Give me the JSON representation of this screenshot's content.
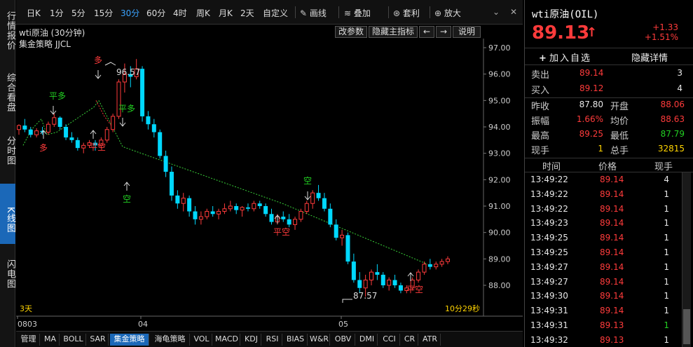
{
  "left_tabs": [
    {
      "label": "行情报价",
      "active": false
    },
    {
      "label": "综合看盘",
      "active": false
    },
    {
      "label": "分时图",
      "active": false
    },
    {
      "label": "K线图",
      "active": true
    },
    {
      "label": "闪电图",
      "active": false
    }
  ],
  "toolbar": {
    "periods": [
      "日K",
      "1分",
      "5分",
      "15分",
      "30分",
      "60分",
      "4时",
      "周K",
      "月K",
      "2天",
      "自定义"
    ],
    "active_period": "30分",
    "tools": [
      {
        "label": "画线",
        "icon": "pencil-icon"
      },
      {
        "label": "叠加",
        "icon": "stack-icon"
      },
      {
        "label": "套利",
        "icon": "arbitrage-icon"
      },
      {
        "label": "放大",
        "icon": "zoom-in-icon"
      }
    ]
  },
  "chart_header": {
    "title": "wti原油 (30分钟)",
    "buttons": [
      "改参数",
      "隐藏主指标",
      "←",
      "→",
      "说明"
    ],
    "indicator": "集金策略 JJCL"
  },
  "chart_data": {
    "type": "candlestick",
    "instrument": "wti原油 (30分钟)",
    "y_ticks": [
      97.0,
      96.0,
      95.0,
      94.0,
      93.0,
      92.0,
      91.0,
      90.0,
      89.0,
      88.0
    ],
    "ylim": [
      87.1,
      97.3
    ],
    "x_ticks": [
      "0803",
      "04",
      "05"
    ],
    "annotations": {
      "high": "96.57",
      "low": "87.57",
      "span": "3天",
      "countdown": "10分29秒"
    },
    "signals": [
      {
        "text": "多",
        "color": "#ff3b3b"
      },
      {
        "text": "平多",
        "color": "#22d022"
      },
      {
        "text": "多",
        "color": "#ff3b3b"
      },
      {
        "text": "平空",
        "color": "#ff3b3b"
      },
      {
        "text": "平多",
        "color": "#22d022"
      },
      {
        "text": "空",
        "color": "#22d022"
      },
      {
        "text": "平空",
        "color": "#ff3b3b"
      },
      {
        "text": "空",
        "color": "#22d022"
      },
      {
        "text": "平空",
        "color": "#ff3b3b"
      }
    ],
    "candles": [
      [
        93.9,
        94.1,
        93.7,
        94.05
      ],
      [
        94.05,
        94.3,
        93.8,
        93.9
      ],
      [
        93.9,
        94.0,
        93.6,
        93.7
      ],
      [
        93.7,
        93.95,
        93.6,
        93.85
      ],
      [
        93.85,
        94.0,
        93.7,
        93.8
      ],
      [
        93.8,
        94.2,
        93.7,
        94.1
      ],
      [
        94.1,
        94.5,
        94.0,
        94.35
      ],
      [
        94.35,
        94.4,
        93.9,
        94.0
      ],
      [
        94.0,
        94.1,
        93.5,
        93.6
      ],
      [
        93.6,
        93.8,
        93.4,
        93.5
      ],
      [
        93.5,
        93.6,
        93.1,
        93.2
      ],
      [
        93.2,
        93.4,
        93.0,
        93.3
      ],
      [
        93.3,
        93.5,
        93.2,
        93.4
      ],
      [
        93.4,
        93.5,
        93.1,
        93.3
      ],
      [
        93.3,
        93.6,
        93.2,
        93.5
      ],
      [
        93.5,
        94.0,
        93.4,
        93.9
      ],
      [
        93.9,
        94.5,
        93.8,
        94.4
      ],
      [
        94.4,
        95.8,
        94.3,
        95.7
      ],
      [
        95.7,
        96.4,
        95.3,
        96.0
      ],
      [
        96.0,
        96.3,
        95.5,
        95.9
      ],
      [
        95.9,
        96.57,
        95.8,
        96.2
      ],
      [
        96.2,
        96.3,
        94.2,
        94.4
      ],
      [
        94.4,
        94.6,
        93.9,
        94.1
      ],
      [
        94.1,
        94.3,
        93.6,
        93.8
      ],
      [
        93.8,
        93.9,
        92.8,
        92.9
      ],
      [
        92.9,
        93.1,
        92.1,
        92.3
      ],
      [
        92.3,
        92.5,
        91.2,
        91.4
      ],
      [
        91.4,
        91.6,
        90.9,
        91.1
      ],
      [
        91.1,
        91.5,
        90.8,
        91.3
      ],
      [
        91.3,
        91.4,
        90.6,
        90.8
      ],
      [
        90.8,
        91.0,
        90.3,
        90.5
      ],
      [
        90.5,
        90.8,
        90.3,
        90.6
      ],
      [
        90.6,
        90.9,
        90.5,
        90.8
      ],
      [
        90.8,
        91.0,
        90.6,
        90.7
      ],
      [
        90.7,
        90.9,
        90.5,
        90.8
      ],
      [
        90.8,
        91.1,
        90.7,
        90.9
      ],
      [
        90.9,
        91.2,
        90.8,
        91.0
      ],
      [
        91.0,
        91.1,
        90.7,
        90.85
      ],
      [
        90.85,
        91.0,
        90.6,
        90.95
      ],
      [
        90.95,
        91.1,
        90.8,
        90.9
      ],
      [
        90.9,
        91.2,
        90.8,
        91.1
      ],
      [
        91.1,
        91.2,
        90.9,
        91.0
      ],
      [
        91.0,
        91.1,
        90.6,
        90.7
      ],
      [
        90.7,
        90.9,
        90.3,
        90.4
      ],
      [
        90.4,
        90.7,
        90.3,
        90.6
      ],
      [
        90.6,
        90.8,
        90.4,
        90.5
      ],
      [
        90.5,
        90.7,
        90.2,
        90.3
      ],
      [
        90.3,
        90.6,
        90.1,
        90.5
      ],
      [
        90.5,
        90.9,
        90.4,
        90.8
      ],
      [
        90.8,
        91.2,
        90.7,
        91.1
      ],
      [
        91.1,
        91.6,
        90.9,
        91.5
      ],
      [
        91.5,
        91.8,
        91.2,
        91.3
      ],
      [
        91.3,
        91.5,
        90.8,
        90.9
      ],
      [
        90.9,
        91.1,
        90.2,
        90.3
      ],
      [
        90.3,
        90.5,
        89.7,
        89.8
      ],
      [
        89.8,
        90.1,
        89.5,
        89.9
      ],
      [
        89.9,
        90.0,
        88.8,
        88.9
      ],
      [
        88.9,
        89.2,
        88.1,
        88.2
      ],
      [
        88.2,
        88.5,
        87.7,
        87.9
      ],
      [
        87.9,
        88.4,
        87.57,
        88.2
      ],
      [
        88.2,
        88.6,
        88.0,
        88.5
      ],
      [
        88.5,
        88.8,
        88.2,
        88.4
      ],
      [
        88.4,
        88.5,
        87.9,
        88.0
      ],
      [
        88.0,
        88.3,
        87.8,
        88.2
      ],
      [
        88.2,
        88.4,
        87.9,
        88.0
      ],
      [
        88.0,
        88.1,
        87.7,
        87.8
      ],
      [
        87.8,
        88.0,
        87.7,
        87.9
      ],
      [
        87.9,
        88.3,
        87.8,
        88.2
      ],
      [
        88.2,
        88.6,
        88.1,
        88.5
      ],
      [
        88.5,
        88.9,
        88.4,
        88.8
      ],
      [
        88.8,
        89.0,
        88.6,
        88.7
      ],
      [
        88.7,
        88.9,
        88.6,
        88.8
      ],
      [
        88.8,
        89.0,
        88.7,
        88.9
      ],
      [
        88.9,
        89.1,
        88.8,
        89.0
      ]
    ]
  },
  "quote": {
    "name": "wti原油(OIL)",
    "price": "89.13",
    "arrow": "↑",
    "change": "+1.33",
    "change_pct": "+1.51%",
    "add_watch": "加入自选",
    "hide_detail": "隐藏详情",
    "sell_label": "卖出",
    "sell_price": "89.14",
    "sell_qty": "3",
    "buy_label": "买入",
    "buy_price": "89.12",
    "buy_qty": "4",
    "stats": [
      {
        "l1": "昨收",
        "v1": "87.80",
        "c1": "white",
        "l2": "开盘",
        "v2": "88.06",
        "c2": "red"
      },
      {
        "l1": "振幅",
        "v1": "1.66%",
        "c1": "red",
        "l2": "均价",
        "v2": "88.63",
        "c2": "red"
      },
      {
        "l1": "最高",
        "v1": "89.25",
        "c1": "red",
        "l2": "最低",
        "v2": "87.79",
        "c2": "green"
      },
      {
        "l1": "现手",
        "v1": "1",
        "c1": "yellow",
        "l2": "总手",
        "v2": "32815",
        "c2": "yellow"
      }
    ],
    "ticks_header": [
      "时间",
      "价格",
      "现手"
    ],
    "ticks": [
      {
        "time": "13:49:22",
        "price": "89.14",
        "pc": "red",
        "qty": "4",
        "qc": "white"
      },
      {
        "time": "13:49:22",
        "price": "89.14",
        "pc": "red",
        "qty": "1",
        "qc": "white"
      },
      {
        "time": "13:49:22",
        "price": "89.14",
        "pc": "red",
        "qty": "1",
        "qc": "white"
      },
      {
        "time": "13:49:23",
        "price": "89.14",
        "pc": "red",
        "qty": "1",
        "qc": "white"
      },
      {
        "time": "13:49:25",
        "price": "89.14",
        "pc": "red",
        "qty": "1",
        "qc": "white"
      },
      {
        "time": "13:49:25",
        "price": "89.14",
        "pc": "red",
        "qty": "1",
        "qc": "white"
      },
      {
        "time": "13:49:27",
        "price": "89.14",
        "pc": "red",
        "qty": "1",
        "qc": "white"
      },
      {
        "time": "13:49:27",
        "price": "89.14",
        "pc": "red",
        "qty": "1",
        "qc": "white"
      },
      {
        "time": "13:49:30",
        "price": "89.14",
        "pc": "red",
        "qty": "1",
        "qc": "white"
      },
      {
        "time": "13:49:31",
        "price": "89.14",
        "pc": "red",
        "qty": "1",
        "qc": "white"
      },
      {
        "time": "13:49:31",
        "price": "89.13",
        "pc": "red",
        "qty": "1",
        "qc": "green"
      },
      {
        "time": "13:49:32",
        "price": "89.13",
        "pc": "red",
        "qty": "1",
        "qc": "white"
      }
    ]
  },
  "bottom_tabs": [
    "管理",
    "MA",
    "BOLL",
    "SAR",
    "集金策略",
    "海龟策略",
    "VOL",
    "MACD",
    "KDJ",
    "RSI",
    "BIAS",
    "W&R",
    "OBV",
    "DMI",
    "CCI",
    "CR",
    "ATR"
  ],
  "bottom_active": "集金策略",
  "colors": {
    "up": "#ff3b3b",
    "down": "#00d8ff",
    "signal_line": "#39d039",
    "accent": "#1b68b8"
  }
}
